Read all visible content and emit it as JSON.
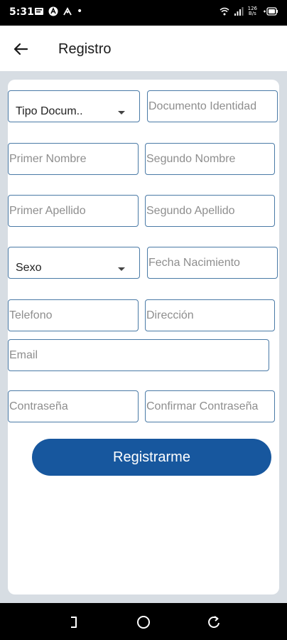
{
  "status_bar": {
    "time": "5:31",
    "net_speed_top": "126",
    "net_speed_bottom": "B/s",
    "left_icons": [
      "message-icon",
      "app-a-icon",
      "accessibility-icon",
      "dot-icon"
    ],
    "right_icons": [
      "wifi-icon",
      "signal-icon",
      "battery-icon"
    ]
  },
  "app_bar": {
    "title": "Registro",
    "back_icon": "arrow-left-icon"
  },
  "form": {
    "tipo_documento": "Tipo Docum..",
    "documento_identidad_placeholder": "Documento Identidad",
    "primer_nombre_placeholder": "Primer Nombre",
    "segundo_nombre_placeholder": "Segundo Nombre",
    "primer_apellido_placeholder": "Primer Apellido",
    "segundo_apellido_placeholder": "Segundo Apellido",
    "sexo": "Sexo",
    "fecha_nacimiento_placeholder": "Fecha Nacimiento",
    "telefono_placeholder": "Telefono",
    "direccion_placeholder": "Dirección",
    "email_placeholder": "Email",
    "contrasena_placeholder": "Contraseña",
    "confirmar_contrasena_placeholder": "Confirmar Contraseña",
    "submit_label": "Registrarme"
  },
  "nav_bar": {
    "icons": [
      "recents-icon",
      "home-icon",
      "back-nav-icon"
    ]
  },
  "colors": {
    "primary": "#17579e",
    "field_border": "#4a7aa6",
    "background": "#d7dde3"
  }
}
